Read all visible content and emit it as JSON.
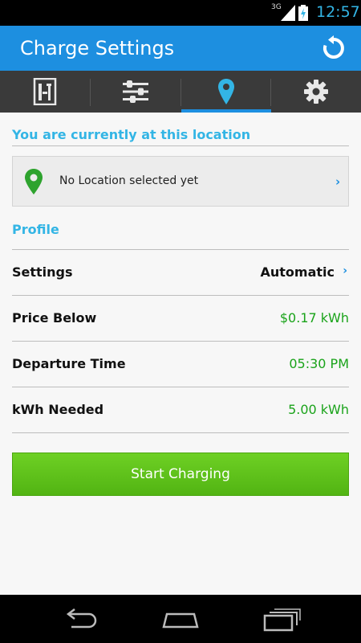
{
  "status_bar": {
    "network": "3G",
    "time": "12:57"
  },
  "action_bar": {
    "title": "Charge Settings",
    "refresh_icon": "refresh-icon"
  },
  "tabs": [
    {
      "icon": "charger-icon",
      "selected": false
    },
    {
      "icon": "sliders-icon",
      "selected": false
    },
    {
      "icon": "location-pin-icon",
      "selected": true
    },
    {
      "icon": "gear-icon",
      "selected": false
    }
  ],
  "location": {
    "header": "You are currently at this location",
    "value": "No Location selected yet"
  },
  "profile": {
    "header": "Profile",
    "rows": [
      {
        "label": "Settings",
        "value": "Automatic"
      },
      {
        "label": "Price Below",
        "value": "$0.17 kWh"
      },
      {
        "label": "Departure Time",
        "value": "05:30 PM"
      },
      {
        "label": "kWh Needed",
        "value": "5.00 kWh"
      }
    ]
  },
  "start_button": {
    "label": "Start Charging"
  },
  "colors": {
    "accent_blue": "#1d8fe0",
    "header_blue": "#33b5e5",
    "value_green": "#1aa31a",
    "button_green": "#5cc21a"
  }
}
